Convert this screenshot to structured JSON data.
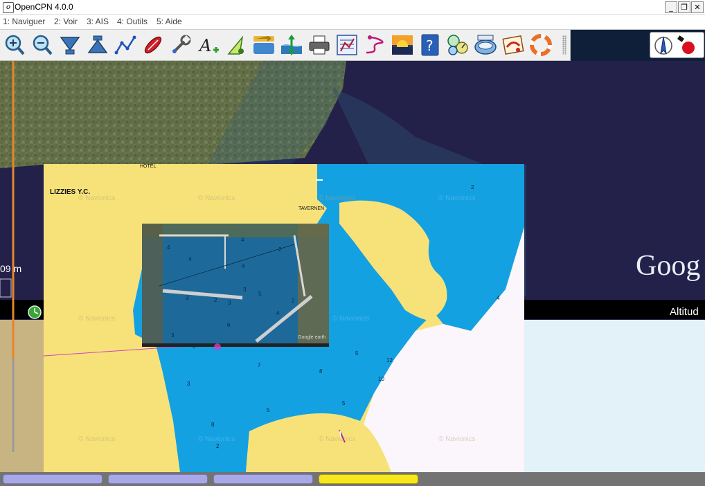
{
  "window": {
    "title": "OpenCPN 4.0.0",
    "controls": {
      "minimize": "_",
      "restore": "❐",
      "close": "✕"
    }
  },
  "menu": [
    {
      "label": "1: Naviguer"
    },
    {
      "label": "2: Voir"
    },
    {
      "label": "3: AIS"
    },
    {
      "label": "4: Outils"
    },
    {
      "label": "5: Aide"
    }
  ],
  "toolbar": [
    {
      "icon": "zoom-in-icon"
    },
    {
      "icon": "zoom-out-icon"
    },
    {
      "icon": "scale-down-icon"
    },
    {
      "icon": "scale-up-icon"
    },
    {
      "icon": "route-icon"
    },
    {
      "icon": "follow-ship-icon"
    },
    {
      "icon": "settings-wrench-icon"
    },
    {
      "icon": "text-add-icon"
    },
    {
      "icon": "ais-target-icon"
    },
    {
      "icon": "current-icon"
    },
    {
      "icon": "tide-icon"
    },
    {
      "icon": "print-icon"
    },
    {
      "icon": "route-manager-icon"
    },
    {
      "icon": "track-icon"
    },
    {
      "icon": "color-scheme-icon"
    },
    {
      "icon": "help-icon"
    },
    {
      "icon": "dashboard-icon"
    },
    {
      "icon": "grib-icon"
    },
    {
      "icon": "logbook-icon"
    },
    {
      "icon": "mob-icon"
    }
  ],
  "map": {
    "colors": {
      "land": "#f7e27a",
      "water": "#14a1e2",
      "satellite_sea": "#23214a"
    },
    "scale_label": "09 m",
    "google_text": "Goog",
    "altitude_text": "Altitud",
    "labels": {
      "hotel": "HOTEL",
      "lizzies": "LIZZIES Y.C.",
      "tavernen": "TAVERNEN"
    },
    "watermark": "© Navionics",
    "depths": [
      "2",
      "4",
      "4",
      "4",
      "2",
      "3",
      "2",
      "4",
      "5",
      "3",
      "2",
      "3",
      "4",
      "6",
      "5",
      "3",
      "7",
      "8",
      "12",
      "10",
      "3",
      "5",
      "5",
      "8",
      "2",
      "4",
      "3"
    ],
    "inset_credit": "Google earth"
  },
  "statusbar": {
    "panes": [
      "",
      "",
      "",
      ""
    ],
    "colors": {
      "pane": "#a8a8e8",
      "active": "#f7e81d"
    }
  }
}
